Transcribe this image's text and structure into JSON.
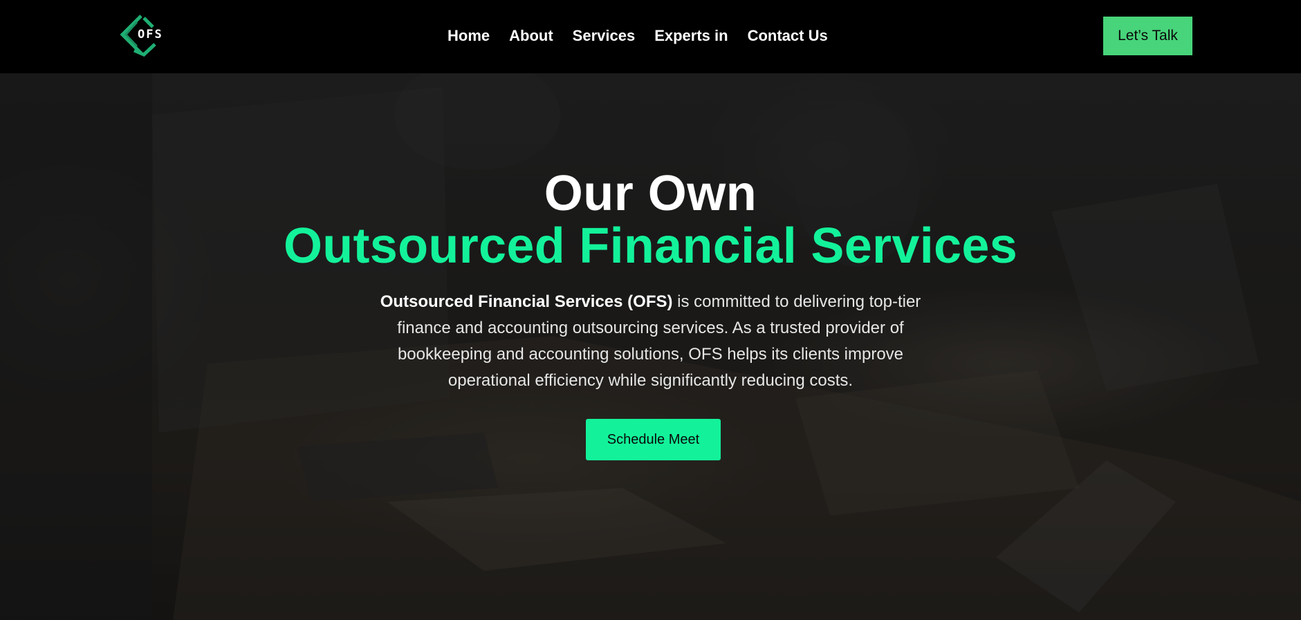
{
  "header": {
    "logo_text": "OFS",
    "nav": [
      {
        "label": "Home"
      },
      {
        "label": "About"
      },
      {
        "label": "Services"
      },
      {
        "label": "Experts in"
      },
      {
        "label": "Contact Us"
      }
    ],
    "cta_label": "Let’s Talk"
  },
  "hero": {
    "title_line1": "Our Own",
    "title_line2": "Outsourced Financial Services",
    "description_strong": "Outsourced Financial Services (OFS)",
    "description_rest": " is committed to delivering top-tier finance and accounting outsourcing services. As a trusted provider of bookkeeping and accounting solutions, OFS helps its clients improve operational efficiency while significantly reducing costs.",
    "button_label": "Schedule Meet"
  },
  "colors": {
    "accent": "#13f29a",
    "cta_green": "#47d47a",
    "header_bg": "#000000",
    "logo_green": "#1fae73"
  },
  "icons": {
    "logo": "ofs-diamond-logo-icon"
  }
}
